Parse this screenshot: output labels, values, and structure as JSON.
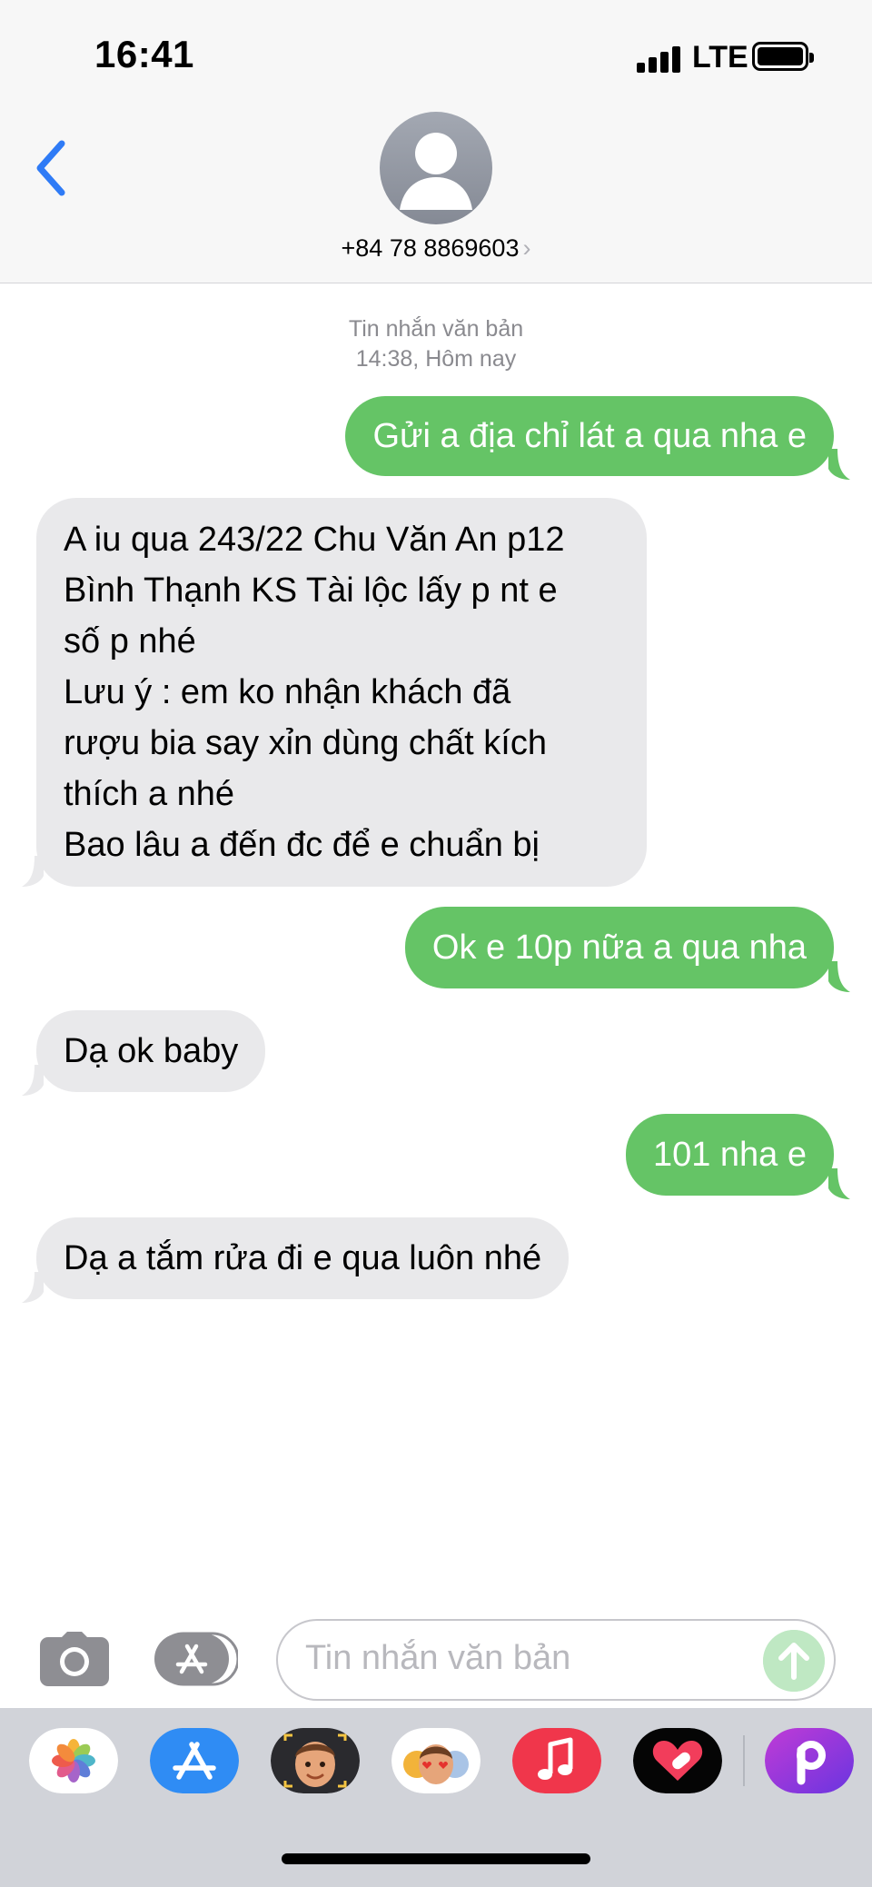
{
  "status_bar": {
    "time": "16:41",
    "network": "LTE",
    "icons": [
      "signal-bars-icon",
      "battery-icon"
    ]
  },
  "header": {
    "back_icon": "chevron-left-icon",
    "avatar_icon": "person-silhouette-icon",
    "contact_number": "+84 78 8869603",
    "contact_chevron": "›"
  },
  "conversation": {
    "timestamp_type": "Tin nhắn văn bản",
    "timestamp_time": "14:38, Hôm nay",
    "messages": [
      {
        "direction": "outgoing",
        "lines": [
          "Gửi a địa chỉ lát a qua nha e"
        ]
      },
      {
        "direction": "incoming",
        "lines": [
          "A iu qua 243/22 Chu Văn An p12",
          "Bình Thạnh KS Tài lộc lấy p nt e",
          "số p nhé",
          "Lưu ý : em ko nhận khách đã",
          "rượu bia say xỉn dùng chất kích",
          "thích a nhé",
          "Bao lâu a đến đc để e chuẩn bị"
        ]
      },
      {
        "direction": "outgoing",
        "lines": [
          "Ok e 10p nữa a qua nha"
        ]
      },
      {
        "direction": "incoming",
        "lines": [
          "Dạ ok baby"
        ]
      },
      {
        "direction": "outgoing",
        "lines": [
          "101 nha e"
        ]
      },
      {
        "direction": "incoming",
        "lines": [
          "Dạ a tắm rửa đi e qua luôn nhé"
        ]
      }
    ]
  },
  "input_bar": {
    "camera_icon": "camera-icon",
    "apps_icon": "app-store-icon",
    "placeholder": "Tin nhắn văn bản",
    "send_icon": "arrow-up-icon"
  },
  "app_drawer": {
    "apps": [
      "photos-icon",
      "app-store-icon",
      "memoji-icon",
      "animoji-stickers-icon",
      "music-icon",
      "digital-touch-icon",
      "picsart-icon"
    ]
  },
  "colors": {
    "outgoing_bubble": "#65c466",
    "incoming_bubble": "#e9e9eb",
    "ios_blue": "#2f7bf6",
    "header_bg": "#f7f7f7"
  }
}
